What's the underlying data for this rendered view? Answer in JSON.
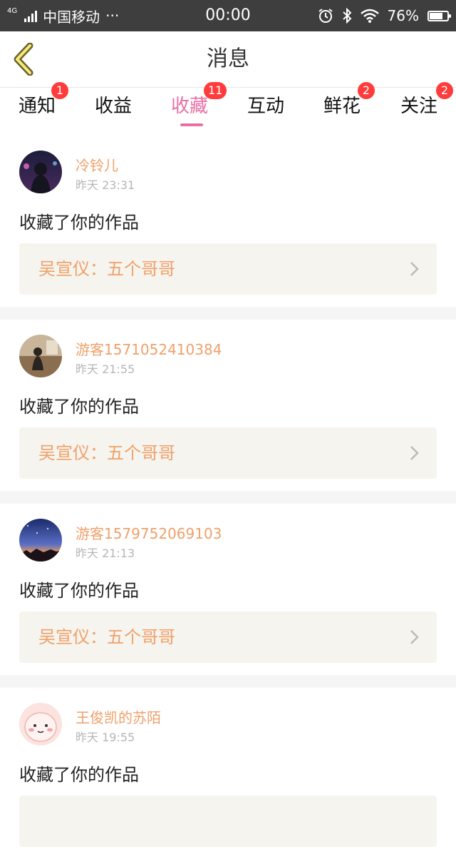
{
  "status_bar": {
    "network": "4G",
    "carrier": "中国移动",
    "more": "···",
    "time": "00:00",
    "battery": "76%",
    "battery_level": 0.76,
    "icons": [
      "alarm-icon",
      "bluetooth-icon",
      "wifi-icon",
      "battery-icon"
    ]
  },
  "header": {
    "title": "消息",
    "back_icon": "chevron-left-icon"
  },
  "tabs": [
    {
      "label": "通知",
      "badge": "1"
    },
    {
      "label": "收益",
      "badge": ""
    },
    {
      "label": "收藏",
      "badge": "11",
      "active": true
    },
    {
      "label": "互动",
      "badge": ""
    },
    {
      "label": "鲜花",
      "badge": "2"
    },
    {
      "label": "关注",
      "badge": "2"
    }
  ],
  "feed": [
    {
      "name": "冷铃儿",
      "time": "昨天 23:31",
      "content": "收藏了你的作品",
      "card_text": "吴宣仪：五个哥哥"
    },
    {
      "name": "游客1571052410384",
      "time": "昨天 21:55",
      "content": "收藏了你的作品",
      "card_text": "吴宣仪：五个哥哥"
    },
    {
      "name": "游客1579752069103",
      "time": "昨天 21:13",
      "content": "收藏了你的作品",
      "card_text": "吴宣仪：五个哥哥"
    },
    {
      "name": "王俊凯的苏陌",
      "time": "昨天 19:55",
      "content": "收藏了你的作品",
      "card_text": ""
    }
  ],
  "colors": {
    "accent": "#e86fa4",
    "name": "#f0a06a",
    "badge": "#ff3b3b",
    "card_bg": "#f5f4ee"
  }
}
